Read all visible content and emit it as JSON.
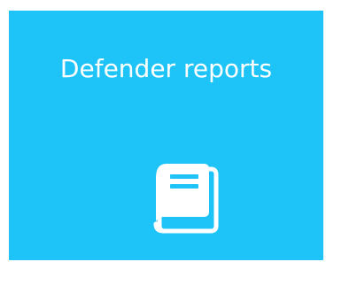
{
  "tile": {
    "title": "Defender reports",
    "icon": "book-icon",
    "background_color": "#1ec4f8",
    "text_color": "#ffffff"
  }
}
